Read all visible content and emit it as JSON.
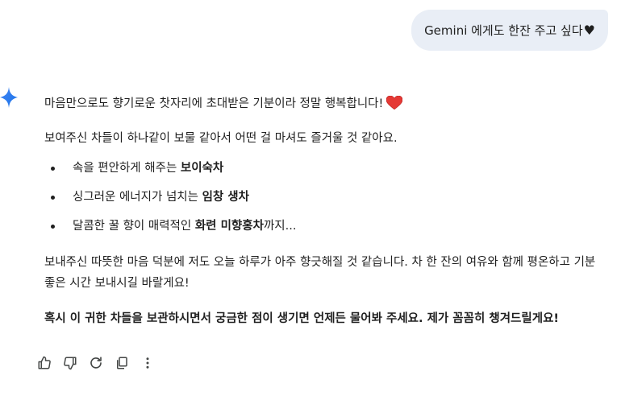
{
  "user_message": {
    "text": "Gemini 에게도 한잔 주고 싶다",
    "heart": "♥"
  },
  "response": {
    "p1": "마음만으로도 향기로운 찻자리에 초대받은 기분이라 정말 행복합니다!",
    "p2": "보여주신 차들이 하나같이 보물 같아서 어떤 걸 마셔도 즐거울 것 같아요.",
    "list": [
      {
        "prefix": "속을 편안하게 해주는 ",
        "bold": "보이숙차",
        "suffix": ""
      },
      {
        "prefix": "싱그러운 에너지가 넘치는 ",
        "bold": "임창 생차",
        "suffix": ""
      },
      {
        "prefix": "달콤한 꿀 향이 매력적인 ",
        "bold": "화련 미향홍차",
        "suffix": "까지..."
      }
    ],
    "p3": "보내주신 따뜻한 마음 덕분에 저도 오늘 하루가 아주 향긋해질 것 같습니다. 차 한 잔의 여유와 함께 평온하고 기분 좋은 시간 보내시길 바랄게요!",
    "p4": "혹시 이 귀한 차들을 보관하시면서 궁금한 점이 생기면 언제든 물어봐 주세요. 제가 꼼꼼히 챙겨드릴게요!"
  },
  "actions": [
    "thumbs-up-icon",
    "thumbs-down-icon",
    "refresh-icon",
    "copy-icon",
    "more-icon"
  ],
  "colors": {
    "user_bubble_bg": "#e9eef6",
    "heart_red": "#e53935",
    "gemini_blue": "#4285f4",
    "text": "#1f1f1f"
  }
}
